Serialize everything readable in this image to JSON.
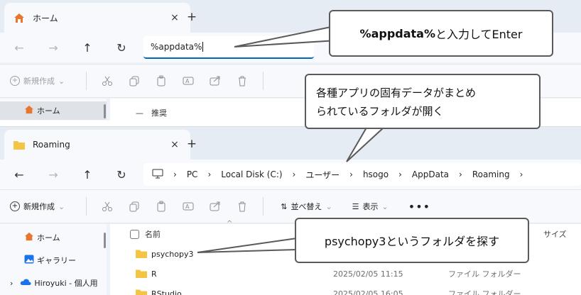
{
  "top": {
    "tab_title": "ホーム",
    "tab_close": "×",
    "new_tab": "+",
    "address_value": "%appdata%",
    "toolbar": {
      "new_label": "新規作成"
    },
    "sidebar_home": "ホーム",
    "content_header_partial": "—　推奨"
  },
  "bottom": {
    "tab_title": "Roaming",
    "tab_close": "×",
    "new_tab": "+",
    "breadcrumb": [
      "PC",
      "Local Disk (C:)",
      "ユーザー",
      "hsogo",
      "AppData",
      "Roaming"
    ],
    "toolbar": {
      "new_label": "新規作成",
      "sort_label": "並べ替え",
      "view_label": "表示",
      "more": "•••"
    },
    "sidebar": [
      {
        "label": "ホーム",
        "icon": "home-icon"
      },
      {
        "label": "ギャラリー",
        "icon": "gallery-icon"
      },
      {
        "label": "Hiroyuki - 個人用",
        "icon": "cloud-icon"
      }
    ],
    "columns": {
      "name": "名前",
      "size": "サイズ"
    },
    "files": [
      {
        "name": "psychopy3",
        "date": "",
        "type": ""
      },
      {
        "name": "R",
        "date": "2025/02/05 11:15",
        "type": "ファイル フォルダー"
      },
      {
        "name": "RStudio",
        "date": "2025/02/05 16:05",
        "type": "ファイル フォルダー"
      }
    ]
  },
  "callouts": {
    "enter": {
      "bold": "%appdata%",
      "rest": "と入力してEnter"
    },
    "folder_opens": "各種アプリの固有データがまとめ\nられているフォルダが開く",
    "find": "psychopy3というフォルダを探す"
  },
  "colors": {
    "folder": "#f4c542",
    "accent": "#0067c0",
    "home_icon": "#e8762d",
    "cloud": "#1a73e8",
    "callout_border": "#5a5a5a"
  }
}
